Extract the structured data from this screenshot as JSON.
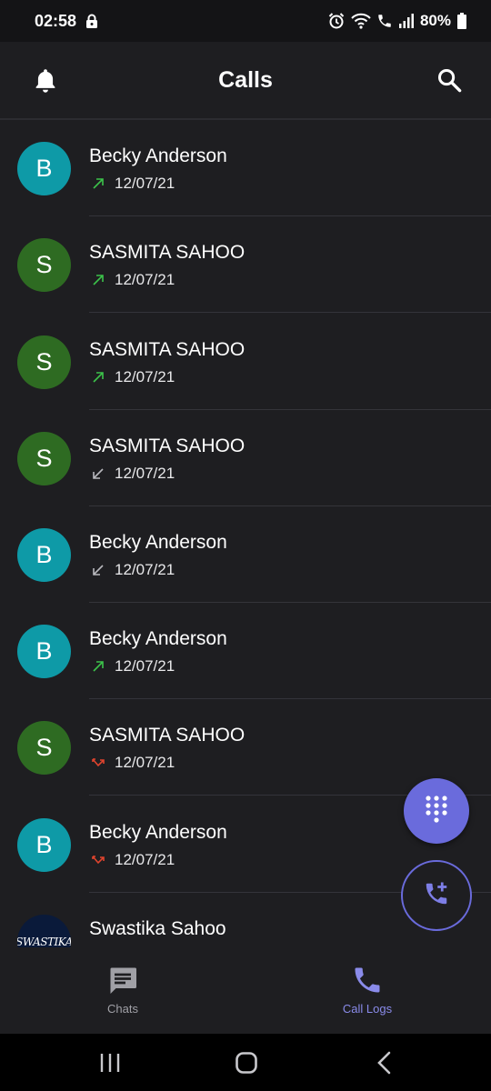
{
  "status_bar": {
    "time": "02:58",
    "battery": "80%"
  },
  "header": {
    "title": "Calls"
  },
  "calls": [
    {
      "initial": "B",
      "name": "Becky Anderson",
      "date": "12/07/21",
      "direction": "outgoing",
      "avatar_color": "#0e9aa7"
    },
    {
      "initial": "S",
      "name": "SASMITA SAHOO",
      "date": "12/07/21",
      "direction": "outgoing",
      "avatar_color": "#2e6b22"
    },
    {
      "initial": "S",
      "name": "SASMITA SAHOO",
      "date": "12/07/21",
      "direction": "outgoing",
      "avatar_color": "#2e6b22"
    },
    {
      "initial": "S",
      "name": "SASMITA SAHOO",
      "date": "12/07/21",
      "direction": "incoming",
      "avatar_color": "#2e6b22"
    },
    {
      "initial": "B",
      "name": "Becky Anderson",
      "date": "12/07/21",
      "direction": "incoming",
      "avatar_color": "#0e9aa7"
    },
    {
      "initial": "B",
      "name": "Becky Anderson",
      "date": "12/07/21",
      "direction": "outgoing",
      "avatar_color": "#0e9aa7"
    },
    {
      "initial": "S",
      "name": "SASMITA SAHOO",
      "date": "12/07/21",
      "direction": "missed",
      "avatar_color": "#2e6b22"
    },
    {
      "initial": "B",
      "name": "Becky Anderson",
      "date": "12/07/21",
      "direction": "missed",
      "avatar_color": "#0e9aa7"
    },
    {
      "initial": "",
      "avatar_text": "SWASTIKA",
      "name": "Swastika Sahoo",
      "date": "",
      "direction": "",
      "avatar_color": "#0a1a3a"
    }
  ],
  "fabs": {
    "dialpad_icon": "dialpad-icon",
    "add_call_icon": "add-call-icon"
  },
  "bottom_nav": {
    "chats_label": "Chats",
    "call_logs_label": "Call Logs"
  },
  "colors": {
    "accent": "#6a6bdc",
    "outgoing": "#3cc24a",
    "incoming": "#b8b8bd",
    "missed": "#e0442e",
    "background": "#1e1e21"
  }
}
